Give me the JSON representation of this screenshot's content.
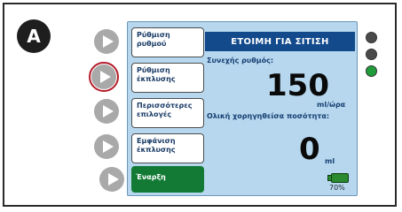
{
  "figure_label": "A",
  "side_buttons": [
    {
      "label_1": "Ρύθμιση",
      "label_2": "ρυθμού"
    },
    {
      "label_1": "Ρύθμιση",
      "label_2": "έκπλυσης"
    },
    {
      "label_1": "Περισσότερες",
      "label_2": "επιλογές"
    },
    {
      "label_1": "Εμφάνιση",
      "label_2": "έκπλυσης"
    }
  ],
  "start_button": "Έναρξη",
  "status_banner": "ΕΤΟΙΜΗ ΓΙΑ ΣΙΤΙΣΗ",
  "rate": {
    "label": "Συνεχής ρυθμός:",
    "value": "150",
    "unit": "ml/ώρα"
  },
  "total": {
    "label": "Ολική χορηγηθείσα ποσότητα:",
    "value": "0",
    "unit": "ml"
  },
  "battery": {
    "percent_text": "70%",
    "level": 0.7
  },
  "indicator_colors": {
    "led1": "#4a4a4a",
    "led2": "#4a4a4a",
    "led3": "#1f9d3a"
  }
}
